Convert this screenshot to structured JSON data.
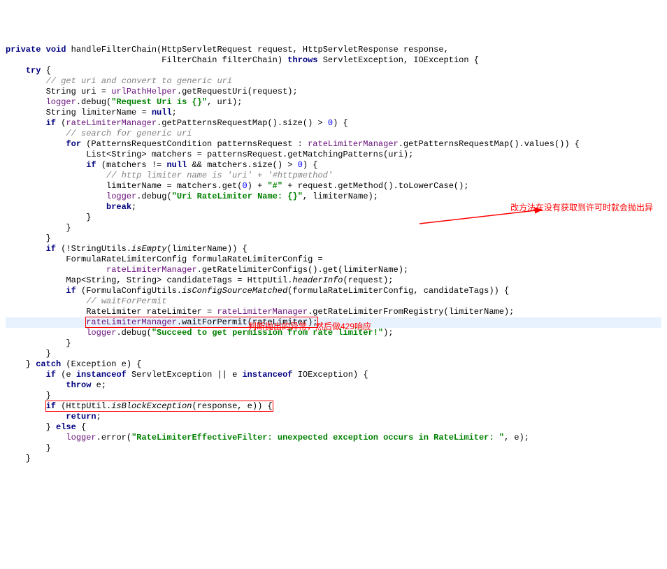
{
  "code": {
    "l1_private": "private",
    "l1_void": "void",
    "l1_method": "handleFilterChain",
    "l1_p1_type": "HttpServletRequest",
    "l1_p1": "request",
    "l1_p2_type": "HttpServletResponse",
    "l1_p2": "response",
    "l2_p3_type": "FilterChain",
    "l2_p3": "filterChain",
    "l2_throws": "throws",
    "l2_ex1": "ServletException",
    "l2_ex2": "IOException",
    "l3_try": "try",
    "l4_comment": "// get uri and convert to generic uri",
    "l5_type": "String",
    "l5_var": "uri",
    "l5_field": "urlPathHelper",
    "l5_call": ".getRequestUri(request);",
    "l6_field": "logger",
    "l6_call": ".debug(",
    "l6_str": "\"Request Uri is {}\"",
    "l6_rest": ", uri);",
    "l7_type": "String",
    "l7_var": "limiterName",
    "l7_eq": " = ",
    "l7_null": "null",
    "l8_if": "if",
    "l8_open": " (",
    "l8_field": "rateLimiterManager",
    "l8_call": ".getPatternsRequestMap().size() > ",
    "l8_zero": "0",
    "l8_close": ") {",
    "l9_comment": "// search for generic uri",
    "l10_for": "for",
    "l10_open": " (PatternsRequestCondition patternsRequest : ",
    "l10_field": "rateLimiterManager",
    "l10_call": ".getPatternsRequestMap().values()) {",
    "l11": "List<String> matchers = patternsRequest.getMatchingPatterns(uri);",
    "l12_if": "if",
    "l12_open": " (matchers != ",
    "l12_null": "null",
    "l12_and": " && matchers.size() > ",
    "l12_zero": "0",
    "l12_close": ") {",
    "l13_comment": "// http limiter name is 'uri' + '#httpmethod'",
    "l14_pre": "limiterName = matchers.get(",
    "l14_zero": "0",
    "l14_mid": ") + ",
    "l14_hash": "\"#\"",
    "l14_rest": " + request.getMethod().toLowerCase();",
    "l15_field": "logger",
    "l15_call": ".debug(",
    "l15_str": "\"Uri RateLimiter Name: {}\"",
    "l15_rest": ", limiterName);",
    "l16_break": "break",
    "l20_if": "if",
    "l20_open": " (!StringUtils.",
    "l20_method": "isEmpty",
    "l20_close": "(limiterName)) {",
    "l21": "FormulaRateLimiterConfig formulaRateLimiterConfig =",
    "l22_field": "rateLimiterManager",
    "l22_call": ".getRatelimiterConfigs().get(limiterName);",
    "l23_pre": "Map<String, String> candidateTags = HttpUtil.",
    "l23_method": "headerInfo",
    "l23_close": "(request);",
    "l24_if": "if",
    "l24_open": " (FormulaConfigUtils.",
    "l24_method": "isConfigSourceMatched",
    "l24_close": "(formulaRateLimiterConfig, candidateTags)) {",
    "l25_comment": "// waitForPermit",
    "l26_pre": "RateLimiter rateLimiter = ",
    "l26_field": "rateLimiterManager",
    "l26_call": ".getRateLimiterFromRegistry(limiterName);",
    "l27_field": "rateLimiterManager",
    "l27_call": ".waitForPermit(rateLimiter);",
    "l28_field": "logger",
    "l28_call": ".debug(",
    "l28_str": "\"Succeed to get permission from rate limiter!\"",
    "l28_close": ");",
    "l32_catch": "catch",
    "l32_open": " (Exception e) {",
    "l33_if": "if",
    "l33_open": " (e ",
    "l33_io1": "instanceof",
    "l33_mid1": " ServletException || e ",
    "l33_io2": "instanceof",
    "l33_mid2": " IOException) {",
    "l34_throw": "throw",
    "l34_rest": " e;",
    "l36_if": "if",
    "l36_open": " (HttpUtil.",
    "l36_method": "isBlockException",
    "l36_close": "(response, e)) {",
    "l37_return": "return",
    "l38_else": "else",
    "l39_field": "logger",
    "l39_call": ".error(",
    "l39_str": "\"RateLimiterEffectiveFilter: unexpected exception occurs in RateLimiter: \"",
    "l39_rest": ", e);"
  },
  "annotations": {
    "a1": "改方法在没有获取到许可时就会抛出异",
    "a2": "判断抛出的异常，然后做429响应"
  }
}
